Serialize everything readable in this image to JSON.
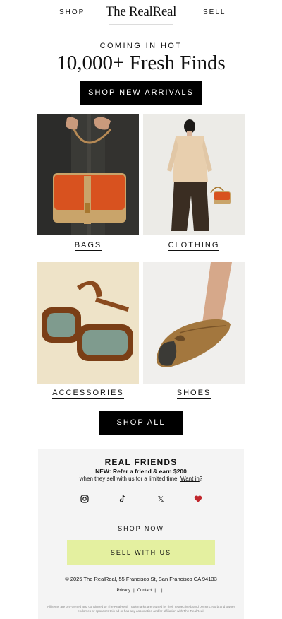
{
  "header": {
    "nav_left": "SHOP",
    "logo": "The RealReal",
    "nav_right": "SELL"
  },
  "hero": {
    "eyebrow": "COMING IN HOT",
    "headline": "10,000+ Fresh Finds",
    "cta_label": "SHOP NEW ARRIVALS"
  },
  "categories": [
    {
      "label": "BAGS",
      "image": "bag-photo"
    },
    {
      "label": "CLOTHING",
      "image": "model-photo"
    },
    {
      "label": "ACCESSORIES",
      "image": "sunglasses-photo"
    },
    {
      "label": "SHOES",
      "image": "flat-shoe-photo"
    }
  ],
  "shop_all_label": "SHOP ALL",
  "footer": {
    "title": "REAL FRIENDS",
    "promo": "NEW: Refer a friend & earn $200",
    "sub_text": "when they sell with us for a limited time.",
    "sub_link": "Want in",
    "sub_end": "?",
    "social_icons": [
      "instagram-icon",
      "tiktok-icon",
      "x-icon",
      "heart-icon"
    ],
    "x_glyph": "𝕏",
    "shop_now": "SHOP NOW",
    "sell_label": "SELL WITH US",
    "address": "© 2025 The RealReal, 55 Francisco St, San Francisco CA 94133",
    "links": [
      "Privacy",
      "Contact"
    ],
    "separator": "|",
    "disclaimer": "All items are pre-owned and consigned to The RealReal. Trademarks are owned by their respective brand owners. No brand owner endorses or sponsors this ad or has any association and/or affiliation with The RealReal."
  },
  "colors": {
    "sell_button": "#e4f0a0",
    "heart": "#c1272d",
    "panel_bg": "#f4f4f4"
  }
}
